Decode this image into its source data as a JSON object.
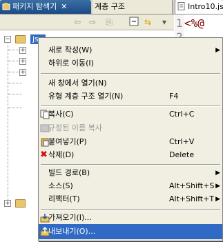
{
  "tabs": {
    "package_explorer": "패키지 탐색기",
    "hierarchy": "계층 구조",
    "editor": "Intro10.js"
  },
  "tree": {
    "project": "jsp"
  },
  "editor": {
    "line1_num": "1",
    "line1_code": "<%@",
    "line2_num": "2"
  },
  "menu": [
    {
      "label": "새로 작성(W)",
      "shortcut": "",
      "submenu": true
    },
    {
      "label": "하위로 이동(I)",
      "shortcut": ""
    },
    {
      "label": "새 창에서 열기(N)",
      "shortcut": ""
    },
    {
      "label": "유형 계층 구조 열기(N)",
      "shortcut": "F4"
    },
    {
      "label": "복사(C)",
      "shortcut": "Ctrl+C"
    },
    {
      "label": "규정된 이름 복사",
      "shortcut": "",
      "disabled": true
    },
    {
      "label": "붙여넣기(P)",
      "shortcut": "Ctrl+V"
    },
    {
      "label": "삭제(D)",
      "shortcut": "Delete"
    },
    {
      "label": "빌드 경로(B)",
      "shortcut": "",
      "submenu": true
    },
    {
      "label": "소스(S)",
      "shortcut": "Alt+Shift+S",
      "submenu": true
    },
    {
      "label": "리팩터(T)",
      "shortcut": "Alt+Shift+T",
      "submenu": true
    },
    {
      "label": "가져오기(I)...",
      "shortcut": ""
    },
    {
      "label": "내보내기(O)...",
      "shortcut": "",
      "highlighted": true
    }
  ]
}
